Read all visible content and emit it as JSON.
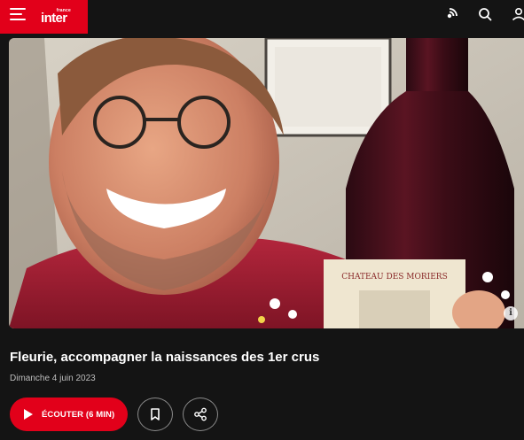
{
  "header": {
    "logo_small": "france",
    "logo_main": "inter",
    "menu_icon": "hamburger-menu-icon",
    "live_icon": "live-broadcast-icon",
    "search_icon": "search-icon",
    "account_icon": "user-account-icon",
    "brand_color": "#e2001a",
    "background_color": "#141414"
  },
  "article": {
    "image_alt": "Homme souriant tenant une bouteille de vin Château des Moriers",
    "bottle_label": "CHATEAU DES MORIERS",
    "info_icon": "i",
    "title": "Fleurie, accompagner la naissances des 1er crus",
    "date": "Dimanche 4 juin 2023"
  },
  "actions": {
    "listen_label": "ÉCOUTER (6 MIN)",
    "listen_icon": "play-icon",
    "bookmark_icon": "bookmark-icon",
    "share_icon": "share-icon"
  }
}
